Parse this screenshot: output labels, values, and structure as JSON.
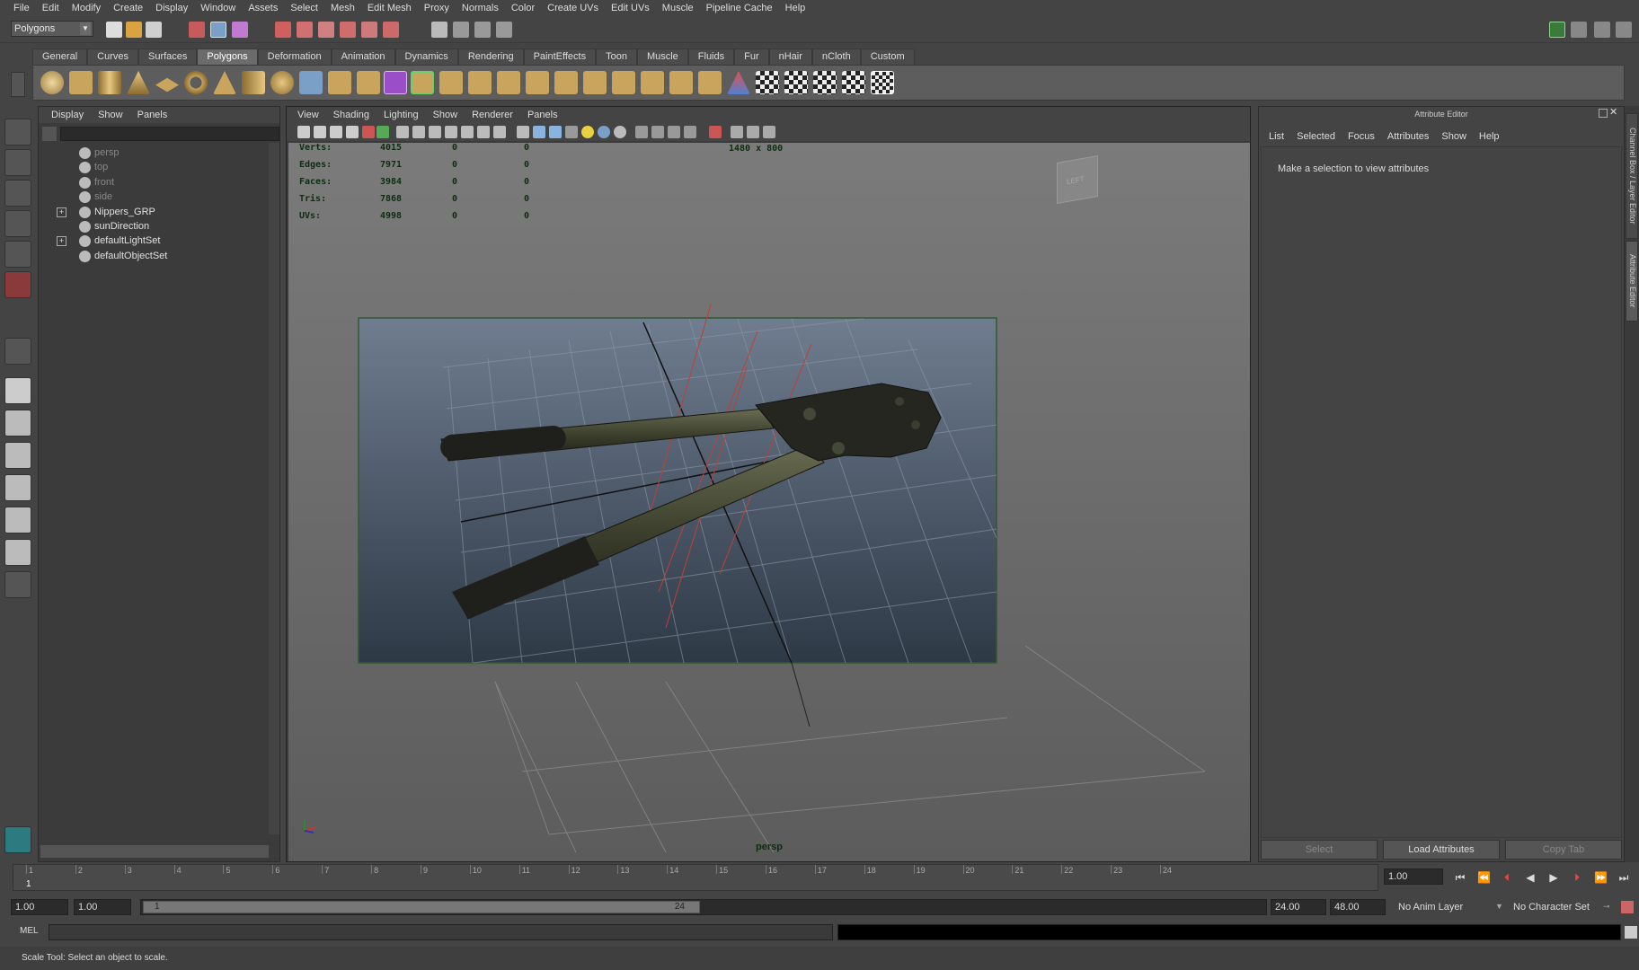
{
  "menubar": [
    "File",
    "Edit",
    "Modify",
    "Create",
    "Display",
    "Window",
    "Assets",
    "Select",
    "Mesh",
    "Edit Mesh",
    "Proxy",
    "Normals",
    "Color",
    "Create UVs",
    "Edit UVs",
    "Muscle",
    "Pipeline Cache",
    "Help"
  ],
  "status": {
    "mode": "Polygons"
  },
  "shelf_tabs": [
    "General",
    "Curves",
    "Surfaces",
    "Polygons",
    "Deformation",
    "Animation",
    "Dynamics",
    "Rendering",
    "PaintEffects",
    "Toon",
    "Muscle",
    "Fluids",
    "Fur",
    "nHair",
    "nCloth",
    "Custom"
  ],
  "shelf_active": "Polygons",
  "outliner": {
    "menu": [
      "Display",
      "Show",
      "Panels"
    ],
    "items": [
      {
        "label": "persp",
        "dim": true,
        "expand": false
      },
      {
        "label": "top",
        "dim": true,
        "expand": false
      },
      {
        "label": "front",
        "dim": true,
        "expand": false
      },
      {
        "label": "side",
        "dim": true,
        "expand": false
      },
      {
        "label": "Nippers_GRP",
        "dim": false,
        "expand": true
      },
      {
        "label": "sunDirection",
        "dim": false,
        "expand": false
      },
      {
        "label": "defaultLightSet",
        "dim": false,
        "expand": true
      },
      {
        "label": "defaultObjectSet",
        "dim": false,
        "expand": false
      }
    ]
  },
  "viewport": {
    "menu": [
      "View",
      "Shading",
      "Lighting",
      "Show",
      "Renderer",
      "Panels"
    ],
    "hud": [
      {
        "k": "Verts:",
        "a": "4015",
        "b": "0",
        "c": "0"
      },
      {
        "k": "Edges:",
        "a": "7971",
        "b": "0",
        "c": "0"
      },
      {
        "k": "Faces:",
        "a": "3984",
        "b": "0",
        "c": "0"
      },
      {
        "k": "Tris:",
        "a": "7868",
        "b": "0",
        "c": "0"
      },
      {
        "k": "UVs:",
        "a": "4998",
        "b": "0",
        "c": "0"
      }
    ],
    "resolution": "1480 x 800",
    "camera": "persp",
    "viewcube_label": "LEFT"
  },
  "attribute_editor": {
    "title": "Attribute Editor",
    "menu": [
      "List",
      "Selected",
      "Focus",
      "Attributes",
      "Show",
      "Help"
    ],
    "message": "Make a selection to view attributes",
    "buttons": [
      "Select",
      "Load Attributes",
      "Copy Tab"
    ]
  },
  "side_tabs": [
    "Channel Box / Layer Editor",
    "Attribute Editor"
  ],
  "timeline": {
    "ticks": [
      "1",
      "2",
      "3",
      "4",
      "5",
      "6",
      "7",
      "8",
      "9",
      "10",
      "11",
      "12",
      "13",
      "14",
      "15",
      "16",
      "17",
      "18",
      "19",
      "20",
      "21",
      "22",
      "23",
      "24"
    ],
    "current": "1",
    "current_field": "1.00"
  },
  "range": {
    "start": "1.00",
    "start2": "1.00",
    "inner_start": "1",
    "inner_end": "24",
    "end": "24.00",
    "end2": "48.00",
    "anim_layer": "No Anim Layer",
    "char_set": "No Character Set"
  },
  "cmd": {
    "label": "MEL"
  },
  "help": {
    "text": "Scale Tool: Select an object to scale."
  }
}
